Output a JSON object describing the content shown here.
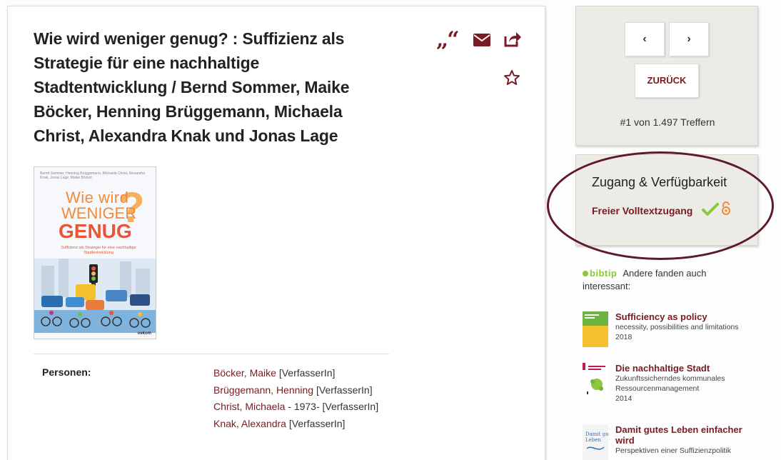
{
  "record": {
    "title": "Wie wird weniger genug? : Suffizienz als Strategie für eine nachhaltige Stadtentwicklung / Bernd Sommer, Maike Böcker, Henning Brüggemann, Michaela Christ, Alexandra Knak und Jonas Lage",
    "cover": {
      "authors": "Bernd Sommer, Henning Brüggemann, Michaela Christ, Alexandra Knak, Jonas Lage, Maike Böcker",
      "line1": "Wie wird",
      "line2": "WENIGER",
      "line3": "GENUG",
      "mark": "?",
      "subtitle": "Suffizienz als Strategie für eine nachhaltige Stadtentwicklung",
      "publisher": "oekom"
    },
    "persons_label": "Personen:",
    "persons": [
      {
        "name": "Böcker, Maike",
        "extra": " [VerfasserIn]"
      },
      {
        "name": "Brüggemann, Henning",
        "extra": " [VerfasserIn]"
      },
      {
        "name": "Christ, Michaela",
        "extra": " - 1973- [VerfasserIn]"
      },
      {
        "name": "Knak, Alexandra",
        "extra": " [VerfasserIn]"
      }
    ]
  },
  "toolbar": {
    "cite_icon": "quote-icon",
    "mail_icon": "mail-icon",
    "share_icon": "share-icon",
    "favorite_icon": "star-icon"
  },
  "navigation": {
    "prev_label": "‹",
    "next_label": "›",
    "back_label": "ZURÜCK",
    "hits_text": "#1 von 1.497 Treffern"
  },
  "access": {
    "title": "Zugang & Verfügbarkeit",
    "link_label": "Freier Volltextzugang",
    "check_icon": "checkmark-icon",
    "oa_icon": "open-access-icon",
    "highlight_color": "#5e1a2c"
  },
  "bibtip": {
    "brand": "bibtip",
    "intro": "Andere fanden auch interessant:",
    "items": [
      {
        "title": "Sufficiency as policy",
        "subtitle": "necessity, possibilities and limitations",
        "year": "2018"
      },
      {
        "title": "Die nachhaltige Stadt",
        "subtitle": "Zukunftssicherndes kommunales Ressourcenmanagement",
        "year": "2014"
      },
      {
        "title": "Damit gutes Leben einfacher wird",
        "subtitle": "Perspektiven einer Suffizienzpolitik",
        "year": ""
      }
    ]
  },
  "colors": {
    "accent": "#7a1a22",
    "panel_bg": "#ecebe5",
    "bibtip_green": "#8dc63f"
  }
}
